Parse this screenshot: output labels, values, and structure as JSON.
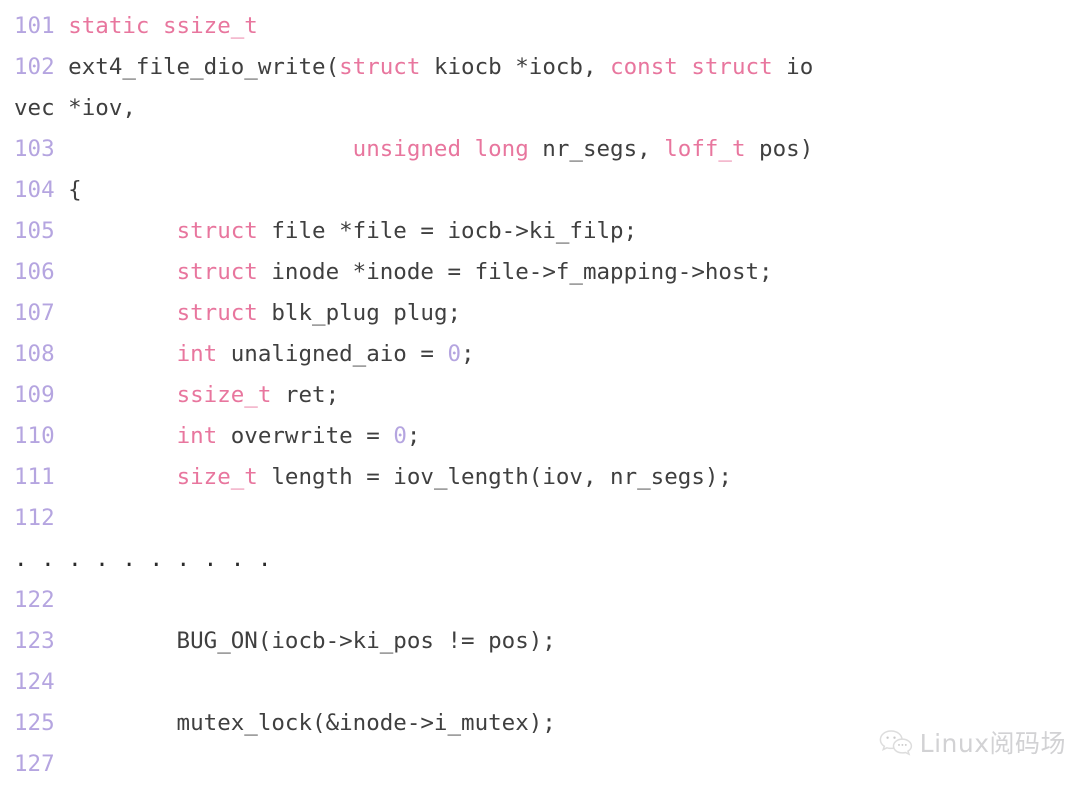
{
  "document": {
    "kind": "source-code-listing",
    "language": "c",
    "function_name": "ext4_file_dio_write",
    "background_color": "#ffffff"
  },
  "theme": {
    "line_number_color": "#b5a5e0",
    "plain_text_color": "#3f3f3f",
    "keyword_color": "#e8769e",
    "number_color": "#b5a5e0",
    "watermark_color": "#d2d2d4"
  },
  "lines": [
    {
      "number": "101",
      "tokens": [
        {
          "t": " ",
          "c": "plain"
        },
        {
          "t": "static ssize_t",
          "c": "kw"
        }
      ]
    },
    {
      "number": "102",
      "tokens": [
        {
          "t": " ext4_file_dio_write(",
          "c": "plain"
        },
        {
          "t": "struct",
          "c": "kw"
        },
        {
          "t": " kiocb *iocb, ",
          "c": "plain"
        },
        {
          "t": "const struct",
          "c": "kw"
        },
        {
          "t": " io",
          "c": "plain"
        }
      ]
    },
    {
      "number": "",
      "tokens": [
        {
          "t": "vec *iov,",
          "c": "plain"
        }
      ]
    },
    {
      "number": "103",
      "tokens": [
        {
          "t": "                      ",
          "c": "plain"
        },
        {
          "t": "unsigned long",
          "c": "kw"
        },
        {
          "t": " nr_segs, ",
          "c": "plain"
        },
        {
          "t": "loff_t",
          "c": "kw"
        },
        {
          "t": " pos)",
          "c": "plain"
        }
      ]
    },
    {
      "number": "104",
      "tokens": [
        {
          "t": " {",
          "c": "plain"
        }
      ]
    },
    {
      "number": "105",
      "tokens": [
        {
          "t": "         ",
          "c": "plain"
        },
        {
          "t": "struct",
          "c": "kw"
        },
        {
          "t": " file *file = iocb->ki_filp;",
          "c": "plain"
        }
      ]
    },
    {
      "number": "106",
      "tokens": [
        {
          "t": "         ",
          "c": "plain"
        },
        {
          "t": "struct",
          "c": "kw"
        },
        {
          "t": " inode *inode = file->f_mapping->host;",
          "c": "plain"
        }
      ]
    },
    {
      "number": "107",
      "tokens": [
        {
          "t": "         ",
          "c": "plain"
        },
        {
          "t": "struct",
          "c": "kw"
        },
        {
          "t": " blk_plug plug;",
          "c": "plain"
        }
      ]
    },
    {
      "number": "108",
      "tokens": [
        {
          "t": "         ",
          "c": "plain"
        },
        {
          "t": "int",
          "c": "kw"
        },
        {
          "t": " unaligned_aio = ",
          "c": "plain"
        },
        {
          "t": "0",
          "c": "num"
        },
        {
          "t": ";",
          "c": "plain"
        }
      ]
    },
    {
      "number": "109",
      "tokens": [
        {
          "t": "         ",
          "c": "plain"
        },
        {
          "t": "ssize_t",
          "c": "kw"
        },
        {
          "t": " ret;",
          "c": "plain"
        }
      ]
    },
    {
      "number": "110",
      "tokens": [
        {
          "t": "         ",
          "c": "plain"
        },
        {
          "t": "int",
          "c": "kw"
        },
        {
          "t": " overwrite = ",
          "c": "plain"
        },
        {
          "t": "0",
          "c": "num"
        },
        {
          "t": ";",
          "c": "plain"
        }
      ]
    },
    {
      "number": "111",
      "tokens": [
        {
          "t": "         ",
          "c": "plain"
        },
        {
          "t": "size_t",
          "c": "kw"
        },
        {
          "t": " length = iov_length(iov, nr_segs);",
          "c": "plain"
        }
      ]
    },
    {
      "number": "112",
      "tokens": []
    },
    {
      "number": "",
      "ellipsis": ". . . . . . . . . ."
    },
    {
      "number": "122",
      "tokens": []
    },
    {
      "number": "123",
      "tokens": [
        {
          "t": "         BUG_ON(iocb->ki_pos != pos);",
          "c": "plain"
        }
      ]
    },
    {
      "number": "124",
      "tokens": []
    },
    {
      "number": "125",
      "tokens": [
        {
          "t": "         mutex_lock(&inode->i_mutex);",
          "c": "plain"
        }
      ]
    },
    {
      "number": "127",
      "tokens": []
    }
  ],
  "watermark": {
    "icon": "wechat-icon",
    "text": "Linux阅码场"
  }
}
